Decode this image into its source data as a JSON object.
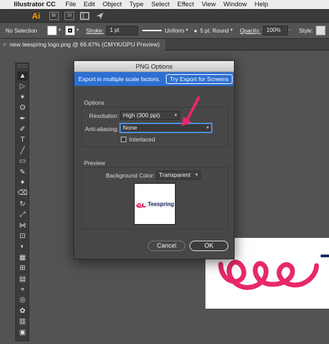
{
  "menubar": {
    "app_name": "Illustrator CC",
    "items": [
      "File",
      "Edit",
      "Object",
      "Type",
      "Select",
      "Effect",
      "View",
      "Window",
      "Help"
    ]
  },
  "appbar": {
    "logo": "Ai",
    "icons": [
      "bridge-icon",
      "stock-icon",
      "workspace-icon",
      "gpu-performance-icon"
    ],
    "icon_glyphs": [
      "Br",
      "St"
    ]
  },
  "controlbar": {
    "selection": "No Selection",
    "stroke_label": "Stroke:",
    "stroke_weight": "1 pt",
    "profile": "Uniform",
    "brush": "5 pt. Round",
    "opacity_label": "Opacity:",
    "opacity_value": "100%",
    "style_label": "Style:"
  },
  "document_tab": {
    "title": "new teespring logo.png @ 66.67% (CMYK/GPU Preview)"
  },
  "toolbar": {
    "tools": [
      "selection-tool",
      "direct-selection-tool",
      "magic-wand-tool",
      "lasso-tool",
      "pen-tool",
      "curvature-tool",
      "type-tool",
      "line-segment-tool",
      "rectangle-tool",
      "paintbrush-tool",
      "shaper-tool",
      "eraser-tool",
      "rotate-tool",
      "scale-tool",
      "width-tool",
      "free-transform-tool",
      "shape-builder-tool",
      "perspective-grid-tool",
      "mesh-tool",
      "gradient-tool",
      "eyedropper-tool",
      "blend-tool",
      "symbol-sprayer-tool",
      "column-graph-tool",
      "artboard-tool"
    ]
  },
  "dialog": {
    "title": "PNG Options",
    "export_message": "Export in multiple scale factors.",
    "try_button": "Try Export for Screens",
    "options_title": "Options",
    "resolution_label": "Resolution:",
    "resolution_value": "High (300 ppi)",
    "antialias_label": "Anti-aliasing:",
    "antialias_value": "None",
    "interlaced_label": "Interlaced",
    "interlaced_checked": false,
    "preview_title": "Preview",
    "background_label": "Background Color:",
    "background_value": "Transparent",
    "preview_logo_text": "Teespring",
    "cancel_label": "Cancel",
    "ok_label": "OK"
  },
  "colors": {
    "accent_blue": "#2d6fd1",
    "brand_pink": "#e8286a",
    "brand_navy": "#1c2a5e",
    "annotation_pink": "#e8286a"
  }
}
